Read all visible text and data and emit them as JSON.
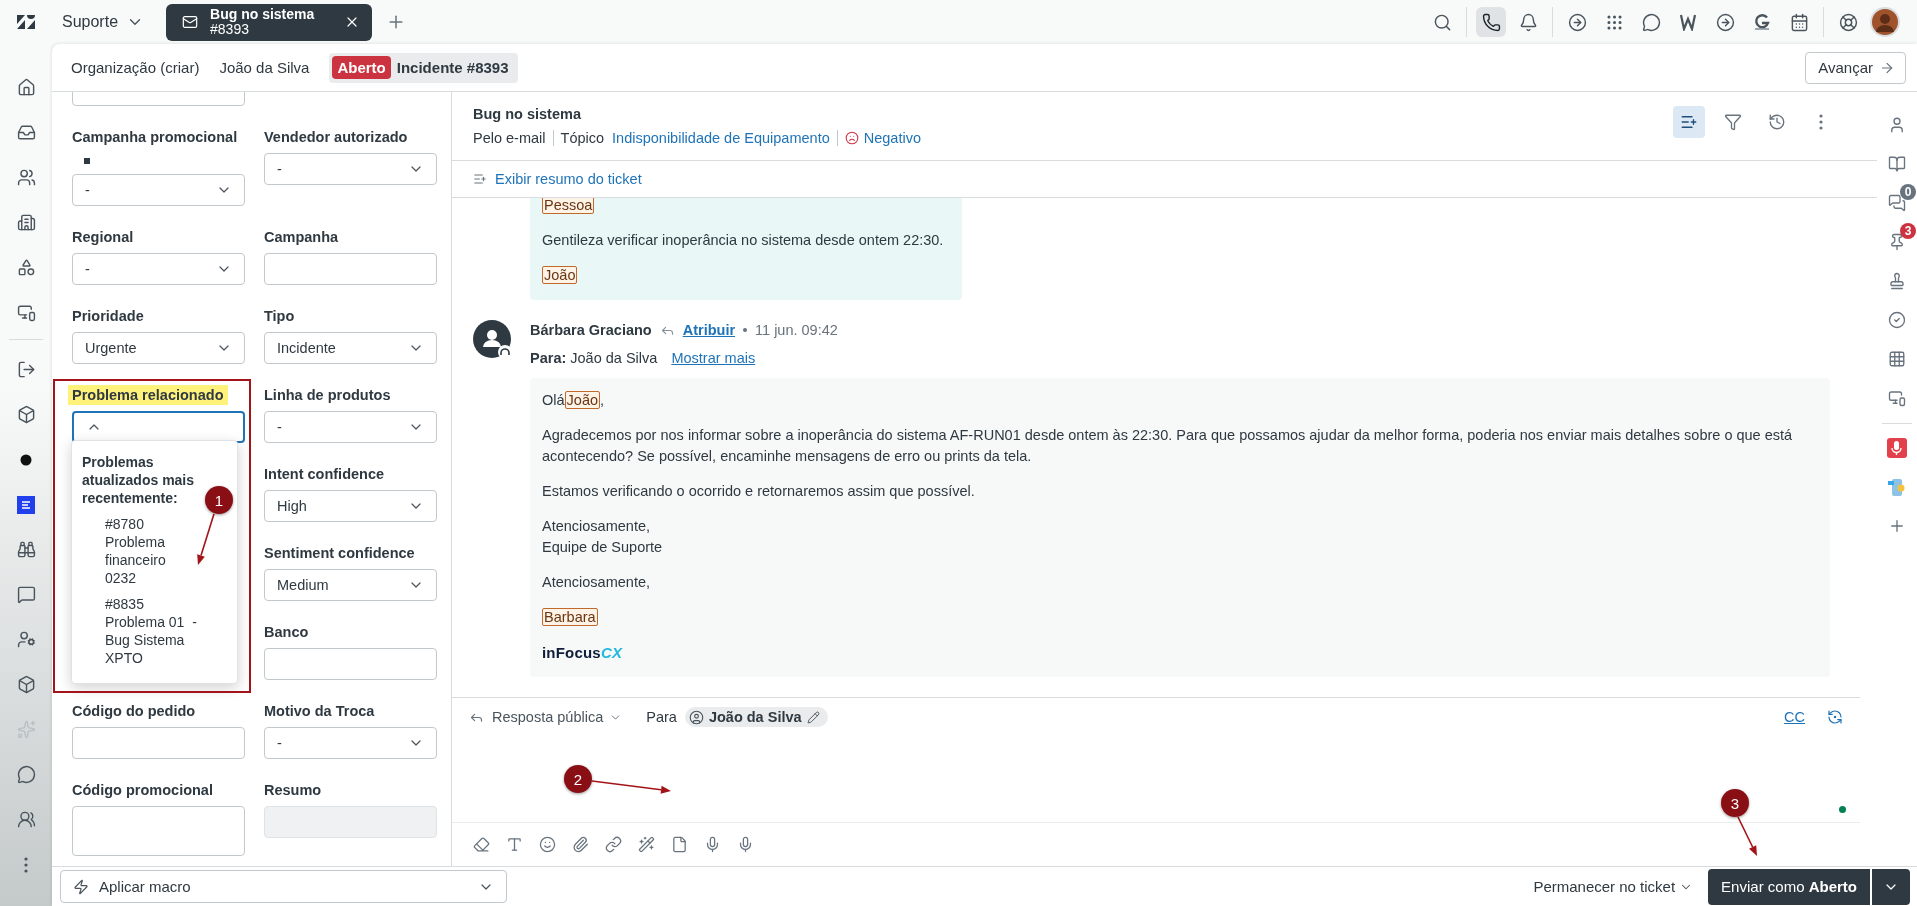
{
  "topbar": {
    "workspace": "Suporte",
    "tabs": [
      {
        "title": "Bug no sistema",
        "subtitle": "#8393",
        "selected": true
      }
    ],
    "tool_groups": [
      [
        {
          "kind": "search",
          "selected": false
        }
      ],
      [
        {
          "kind": "phone",
          "selected": true
        },
        {
          "kind": "bell",
          "selected": false
        }
      ],
      [
        {
          "kind": "arrow-circle",
          "selected": false
        },
        {
          "kind": "dots",
          "selected": false
        },
        {
          "kind": "whatsapp",
          "selected": false
        },
        {
          "kind": "zigzag",
          "selected": false
        },
        {
          "kind": "arrow-circle",
          "selected": false
        },
        {
          "kind": "hook",
          "selected": false
        },
        {
          "kind": "calendar",
          "selected": false
        }
      ],
      [
        {
          "kind": "lifebuoy",
          "selected": false
        },
        {
          "kind": "avatar",
          "selected": false
        }
      ]
    ]
  },
  "nav": [
    {
      "kind": "home",
      "selected": false
    },
    {
      "kind": "inbox",
      "selected": false
    },
    {
      "kind": "users",
      "selected": false
    },
    {
      "kind": "building",
      "selected": false
    },
    {
      "kind": "shapes",
      "selected": false
    },
    {
      "kind": "device",
      "selected": false
    },
    {
      "kind": "divider"
    },
    {
      "kind": "logout",
      "selected": false
    },
    {
      "kind": "box",
      "selected": false
    },
    {
      "kind": "dot",
      "selected": false
    },
    {
      "kind": "app-blue",
      "selected": false
    },
    {
      "kind": "binoculars",
      "selected": false
    },
    {
      "kind": "chat",
      "selected": false
    },
    {
      "kind": "user-cog",
      "selected": false
    },
    {
      "kind": "box",
      "selected": false
    },
    {
      "kind": "sparkles",
      "selected": false
    },
    {
      "kind": "whatsapp",
      "selected": false
    },
    {
      "kind": "group",
      "selected": false
    },
    {
      "kind": "more",
      "selected": false
    }
  ],
  "ticket_tabs": [
    {
      "label": "Organização (criar)",
      "selected": false
    },
    {
      "label": "João da Silva",
      "selected": false
    },
    {
      "status": "Aberto",
      "label": "Incidente #8393",
      "selected": true
    }
  ],
  "next_button": "Avançar",
  "form": {
    "rows": [
      {
        "left": {
          "kind": "text"
        }
      },
      {
        "left": {
          "label": "Campanha promocional",
          "kind": "select",
          "value": "-",
          "marked": true,
          "expanded": false
        },
        "right": {
          "label": "Vendedor autorizado",
          "kind": "select",
          "value": "-",
          "expanded": false
        }
      },
      {
        "left": {
          "label": "Regional",
          "kind": "select",
          "value": "-",
          "expanded": false
        },
        "right": {
          "label": "Campanha",
          "kind": "text"
        }
      },
      {
        "left": {
          "label": "Prioridade",
          "kind": "select",
          "value": "Urgente",
          "expanded": false
        },
        "right": {
          "label": "Tipo",
          "kind": "select",
          "value": "Incidente",
          "expanded": false
        }
      },
      {
        "left": {
          "label": "Problema relacionado",
          "kind": "select",
          "expanded": true,
          "highlighted": true,
          "menu": {
            "heading": "Problemas atualizados mais recentemente:",
            "options": [
              {
                "label": "#8780 Problema financeiro 0232",
                "selected": false
              },
              {
                "label": "#8835 Problema 01  - Bug Sistema XPTO",
                "selected": false
              }
            ]
          }
        },
        "right": {
          "label": "Linha de produtos",
          "kind": "select",
          "value": "-",
          "expanded": false
        }
      },
      {
        "right": {
          "label": "Intent confidence",
          "kind": "select",
          "value": "High",
          "expanded": false
        }
      },
      {
        "right": {
          "label": "Sentiment confidence",
          "kind": "select",
          "value": "Medium",
          "expanded": false
        }
      },
      {
        "right": {
          "label": "Banco",
          "kind": "text"
        }
      },
      {
        "left": {
          "label": "Código do pedido",
          "kind": "text"
        },
        "right": {
          "label": "Motivo da Troca",
          "kind": "select",
          "value": "-",
          "expanded": false
        }
      },
      {
        "left": {
          "label": "Código promocional",
          "kind": "textarea"
        },
        "right": {
          "label": "Resumo",
          "kind": "text",
          "disabled": true
        }
      }
    ]
  },
  "ticket": {
    "subject": "Bug no sistema",
    "channel": "Pelo e-mail",
    "topic_label": "Tópico",
    "topic": "Indisponibilidade de Equipamento",
    "sentiment": "Negativo",
    "summary_link": "Exibir resumo do ticket",
    "tools": [
      {
        "kind": "summary",
        "selected": true
      },
      {
        "kind": "filter",
        "selected": false
      },
      {
        "kind": "history",
        "selected": false
      },
      {
        "kind": "more",
        "selected": false
      }
    ]
  },
  "messages": [
    {
      "kind": "customer",
      "paragraphs": [
        [
          {
            "kind": "tag",
            "text": "Pessoa"
          }
        ],
        [
          {
            "kind": "text",
            "text": "Gentileza verificar inoperância no sistema desde ontem 22:30."
          }
        ],
        [
          {
            "kind": "tag",
            "text": "João"
          }
        ]
      ]
    },
    {
      "kind": "agent",
      "author": "Bárbara Graciano",
      "action": "Atribuir",
      "time": "11 jun. 09:42",
      "recipient": "**Para:** João da Silva",
      "more_link": "Mostrar mais",
      "paragraphs": [
        [
          {
            "kind": "text",
            "text": "Olá"
          },
          {
            "kind": "tag",
            "text": "João"
          },
          {
            "kind": "text",
            "text": ","
          }
        ],
        [
          {
            "kind": "text",
            "text": "Agradecemos por nos informar sobre a inoperância do sistema AF-RUN01 desde ontem às 22:30. Para que possamos ajudar da melhor forma, poderia nos enviar mais detalhes sobre o que está acontecendo? Se possível, encaminhe mensagens de erro ou prints da tela."
          }
        ],
        [
          {
            "kind": "text",
            "text": "Estamos verificando o ocorrido e retornaremos assim que possível."
          }
        ],
        [
          {
            "kind": "text",
            "text": "Atenciosamente,\nEquipe de Suporte"
          }
        ],
        [
          {
            "kind": "text",
            "text": "Atenciosamente,"
          }
        ],
        [
          {
            "kind": "tag",
            "text": "Barbara"
          }
        ]
      ],
      "logo": {
        "main": "inFocus",
        "accent": "CX"
      }
    }
  ],
  "composer": {
    "mode": "Resposta pública",
    "to_label": "Para",
    "recipient": "João da Silva",
    "cc": "CC",
    "tools": [
      {
        "kind": "eraser"
      },
      {
        "kind": "text"
      },
      {
        "kind": "emoji"
      },
      {
        "kind": "attach"
      },
      {
        "kind": "link"
      },
      {
        "kind": "wand"
      },
      {
        "kind": "file"
      },
      {
        "kind": "mic"
      },
      {
        "kind": "mic"
      }
    ]
  },
  "footer": {
    "macro_placeholder": "Aplicar macro",
    "after_send": "Permanecer no ticket",
    "submit": "Enviar como **Aberto**"
  },
  "rail": [
    {
      "kind": "user",
      "selected": false
    },
    {
      "kind": "book",
      "selected": false
    },
    {
      "kind": "conversations",
      "selected": false,
      "badge": "0",
      "color": "#68737d"
    },
    {
      "kind": "pin",
      "selected": false,
      "badge": "3",
      "color": "#cc3340"
    },
    {
      "kind": "stamp",
      "selected": false
    },
    {
      "kind": "check",
      "selected": false
    },
    {
      "kind": "grid",
      "selected": false
    },
    {
      "kind": "device",
      "selected": false
    },
    {
      "kind": "divider"
    },
    {
      "kind": "app-red",
      "selected": false
    },
    {
      "kind": "app-phone",
      "selected": false
    },
    {
      "kind": "plus",
      "selected": false
    }
  ],
  "annotations": {
    "frame": true,
    "markers": [
      {
        "label": "1"
      },
      {
        "label": "2"
      },
      {
        "label": "3"
      }
    ]
  }
}
